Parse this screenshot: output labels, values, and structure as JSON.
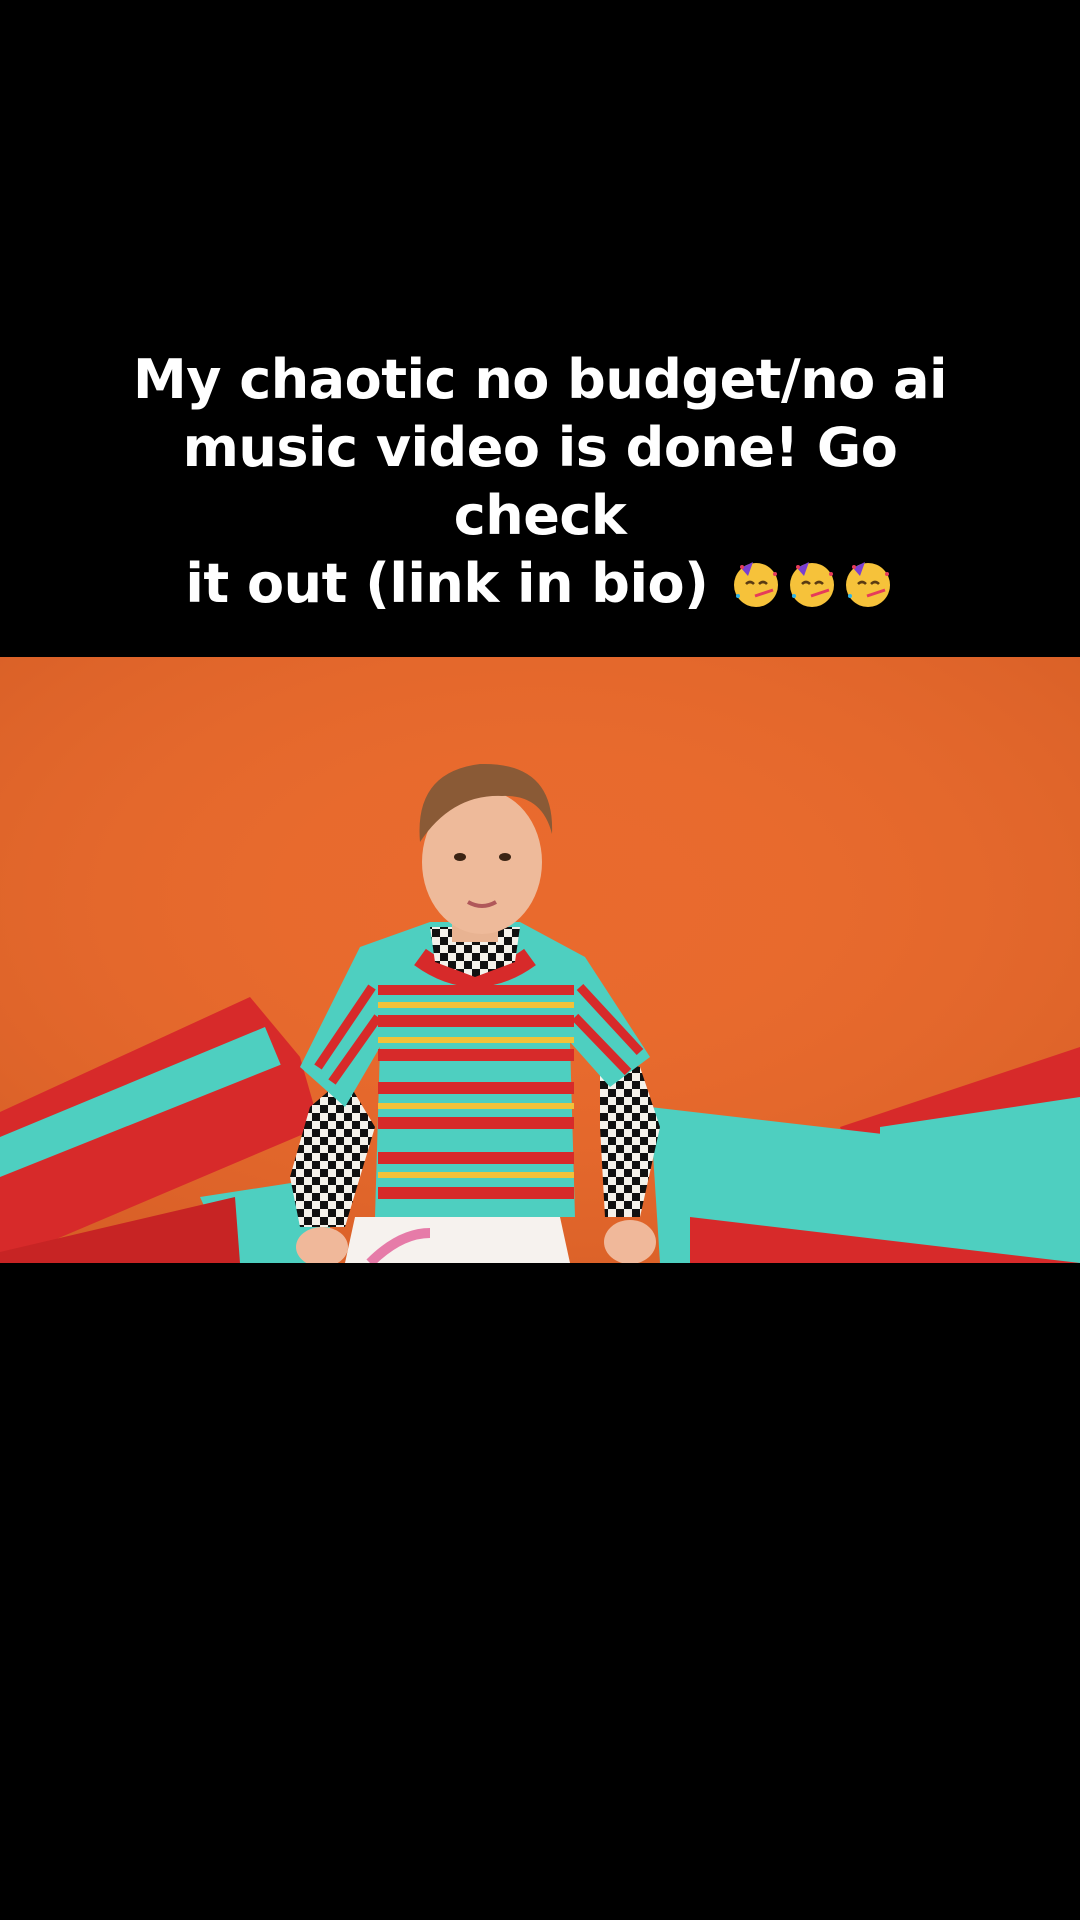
{
  "caption": {
    "line1": "My chaotic no budget/no ai",
    "line2": "music video is done! Go check",
    "line3": "it out (link in bio)",
    "emoji_count": 3,
    "emoji_name": "partying-face-emoji"
  },
  "video": {
    "scene": "paper-cutout-figure-in-striped-shirt",
    "colors": {
      "background": "#e96a2d",
      "red_paper": "#d72a2a",
      "teal_paper": "#4ecfc0",
      "yellow_stripe": "#f2c23a"
    }
  }
}
